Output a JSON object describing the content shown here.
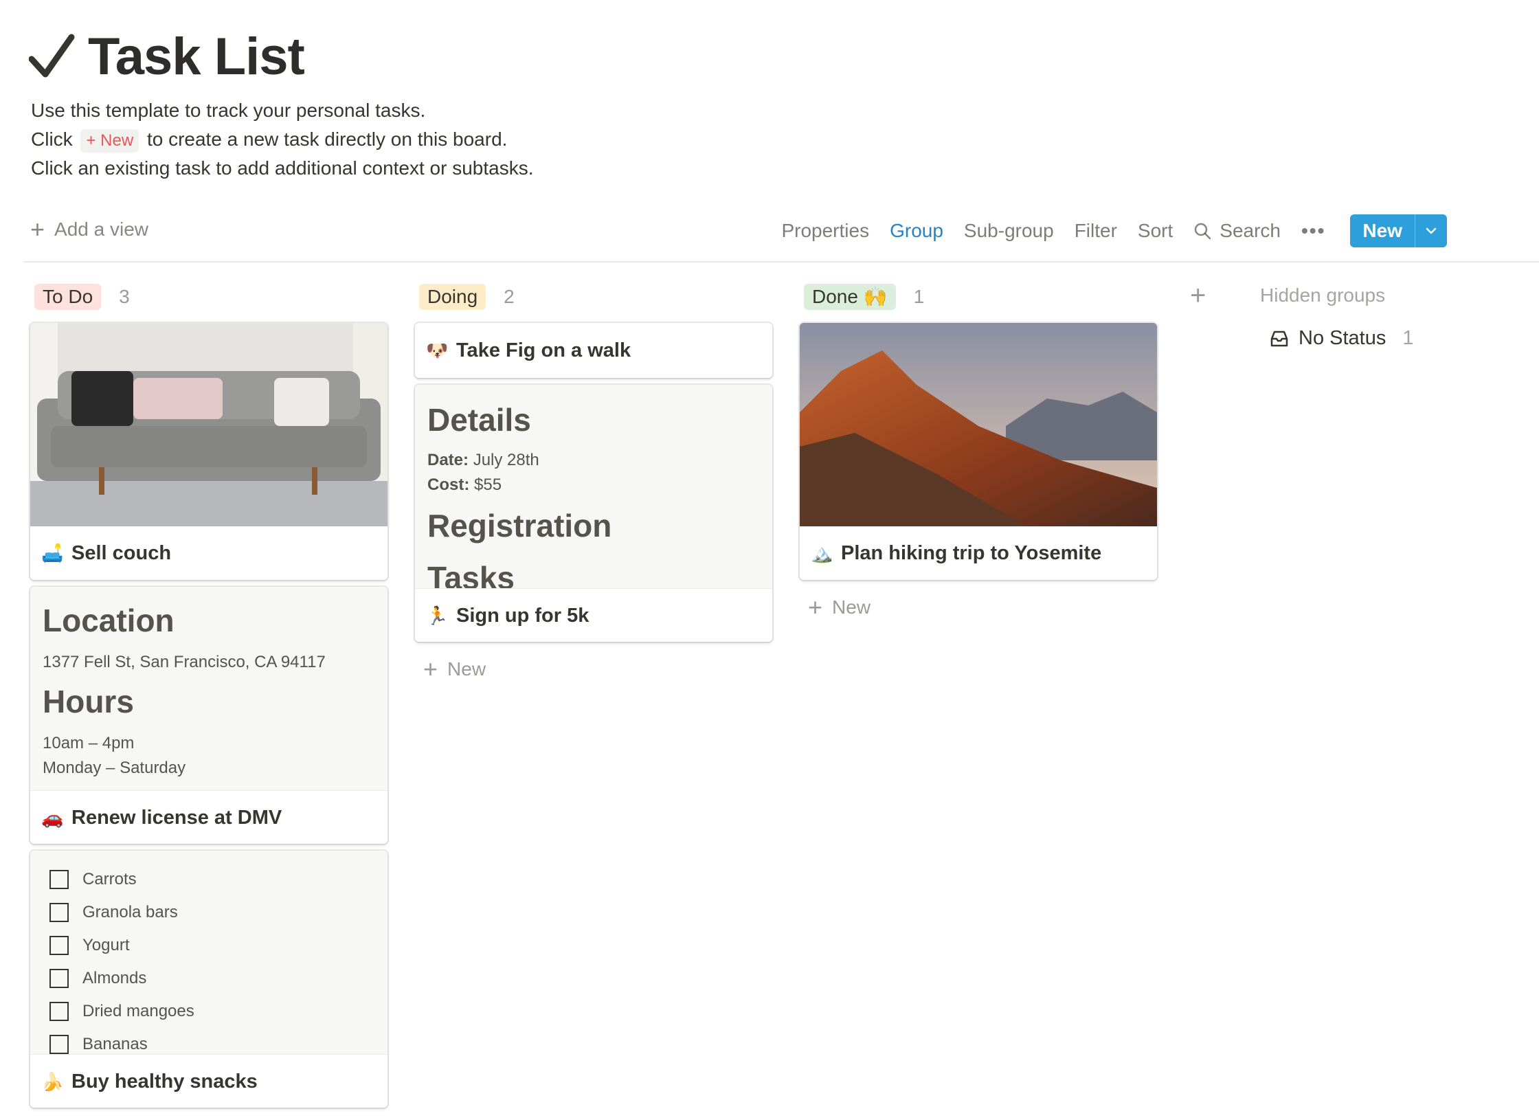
{
  "header": {
    "title": "Task List",
    "desc_line1": "Use this template to track your personal tasks.",
    "desc_line2_before": "Click",
    "desc_line2_inline": "+ New",
    "desc_line2_after": "to create a new task directly on this board.",
    "desc_line3": "Click an existing task to add additional context or subtasks."
  },
  "toolbar": {
    "add_view": "Add a view",
    "properties": "Properties",
    "group": "Group",
    "sub_group": "Sub-group",
    "filter": "Filter",
    "sort": "Sort",
    "search": "Search",
    "more": "•••",
    "new": "New"
  },
  "columns": {
    "todo": {
      "label": "To Do",
      "count": "3",
      "color": "#ffe2dd"
    },
    "doing": {
      "label": "Doing",
      "count": "2",
      "color": "#fdecc8"
    },
    "done": {
      "label": "Done 🙌",
      "count": "1",
      "color": "#dbeddb"
    }
  },
  "cards": {
    "sell_couch": {
      "emoji": "🛋️",
      "title": "Sell couch"
    },
    "dmv": {
      "emoji": "🚗",
      "title": "Renew license at DMV",
      "preview": {
        "h1": "Location",
        "address": "1377 Fell St, San Francisco, CA 94117",
        "h2": "Hours",
        "hours": "10am – 4pm",
        "days": "Monday – Saturday"
      }
    },
    "snacks": {
      "emoji": "🍌",
      "title": "Buy healthy snacks",
      "checklist": [
        "Carrots",
        "Granola bars",
        "Yogurt",
        "Almonds",
        "Dried mangoes",
        "Bananas"
      ]
    },
    "fig": {
      "emoji": "🐶",
      "title": "Take Fig on a walk"
    },
    "fivek": {
      "emoji": "🏃",
      "title": "Sign up for 5k",
      "preview": {
        "h1": "Details",
        "date_label": "Date:",
        "date": "July 28th",
        "cost_label": "Cost:",
        "cost": "$55",
        "h2": "Registration",
        "h3": "Tasks"
      }
    },
    "hiking": {
      "emoji": "🏔️",
      "title": "Plan hiking trip to Yosemite"
    }
  },
  "add_new_label": "New",
  "hidden_groups": {
    "label": "Hidden groups",
    "no_status": "No Status",
    "no_status_count": "1"
  }
}
